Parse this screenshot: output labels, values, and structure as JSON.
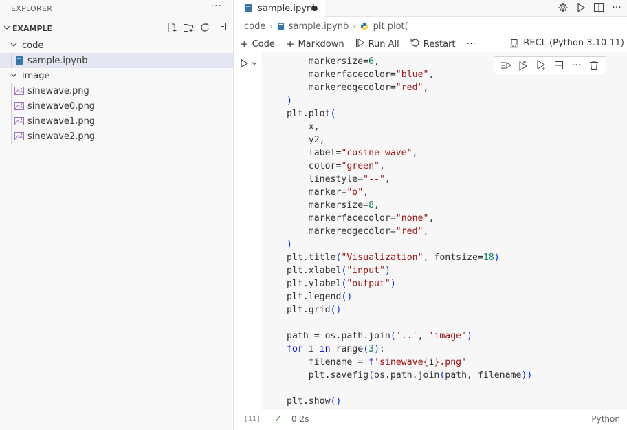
{
  "sidebar": {
    "title": "EXPLORER",
    "folder": "EXAMPLE",
    "tree": [
      {
        "label": "code",
        "type": "folder"
      },
      {
        "label": "sample.ipynb",
        "type": "notebook"
      },
      {
        "label": "image",
        "type": "folder"
      },
      {
        "label": "sinewave.png",
        "type": "image"
      },
      {
        "label": "sinewave0.png",
        "type": "image"
      },
      {
        "label": "sinewave1.png",
        "type": "image"
      },
      {
        "label": "sinewave2.png",
        "type": "image"
      }
    ]
  },
  "editor": {
    "tab_label": "sample.ipynb",
    "breadcrumb": [
      "code",
      "sample.ipynb",
      "plt.plot("
    ],
    "toolbar": {
      "code": "Code",
      "markdown": "Markdown",
      "run_all": "Run All",
      "restart": "Restart",
      "kernel": "RECL (Python 3.10.11)"
    }
  },
  "cell": {
    "exec_count": "[11]",
    "duration": "0.2s",
    "language": "Python"
  },
  "colors": {
    "accent": "#007acc",
    "string": "#a31515",
    "keyword": "#0000ff",
    "success": "#388a34"
  }
}
